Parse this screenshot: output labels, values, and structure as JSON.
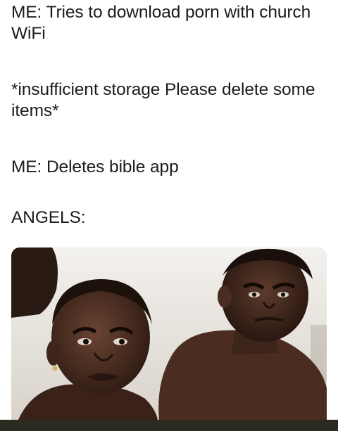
{
  "meme": {
    "captions": [
      "ME: Tries to download porn with church WiFi",
      "*insufficient storage Please delete some items*",
      "ME: Deletes bible app",
      "ANGELS:"
    ],
    "image": {
      "subject": "two-children-glaring-photo",
      "colors": {
        "background": "#ffffff",
        "text": "#1c1c1c",
        "sky": "#ece9e4",
        "skin_dark": "#3b2419",
        "skin_mid": "#5b3a2a",
        "bottom_bar": "#2b2b20"
      }
    }
  }
}
